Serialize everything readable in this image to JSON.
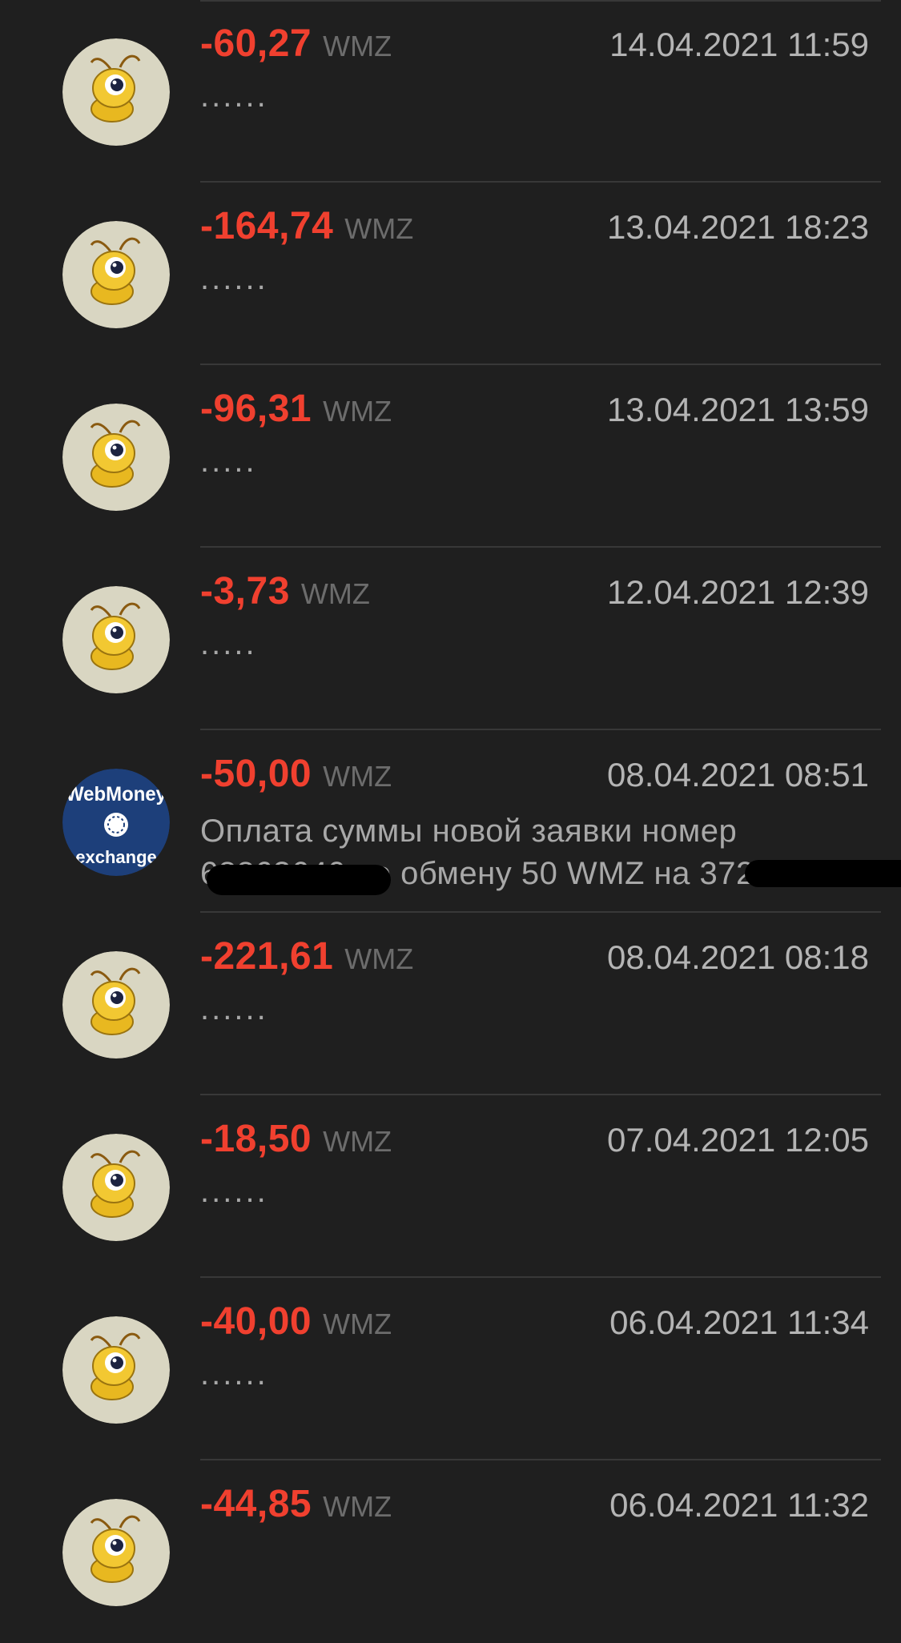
{
  "transactions": [
    {
      "amount": "-60,27",
      "currency": "WMZ",
      "date": "14.04.2021 11:59",
      "description": "......",
      "avatar": "webmoney-ant-logo"
    },
    {
      "amount": "-164,74",
      "currency": "WMZ",
      "date": "13.04.2021 18:23",
      "description": "......",
      "avatar": "webmoney-ant-logo"
    },
    {
      "amount": "-96,31",
      "currency": "WMZ",
      "date": "13.04.2021 13:59",
      "description": ".....",
      "avatar": "webmoney-ant-logo"
    },
    {
      "amount": "-3,73",
      "currency": "WMZ",
      "date": "12.04.2021 12:39",
      "description": ".....",
      "avatar": "webmoney-ant-logo"
    },
    {
      "amount": "-50,00",
      "currency": "WMZ",
      "date": "08.04.2021 08:51",
      "description_line1": "Оплата суммы новой заявки номер",
      "description_line2": "68863640 по обмену 50 WMZ на 372...",
      "avatar": "webmoney-exchange-logo",
      "avatar_text_top": "WebMoney",
      "avatar_text_bottom": "exchange"
    },
    {
      "amount": "-221,61",
      "currency": "WMZ",
      "date": "08.04.2021 08:18",
      "description": "......",
      "avatar": "webmoney-ant-logo"
    },
    {
      "amount": "-18,50",
      "currency": "WMZ",
      "date": "07.04.2021 12:05",
      "description": "......",
      "avatar": "webmoney-ant-logo"
    },
    {
      "amount": "-40,00",
      "currency": "WMZ",
      "date": "06.04.2021 11:34",
      "description": "......",
      "avatar": "webmoney-ant-logo"
    },
    {
      "amount": "-44,85",
      "currency": "WMZ",
      "date": "06.04.2021 11:32",
      "description": "",
      "avatar": "webmoney-ant-logo"
    }
  ],
  "colors": {
    "background": "#1f1f1f",
    "amount_negative": "#f0402f",
    "divider": "#383838"
  }
}
